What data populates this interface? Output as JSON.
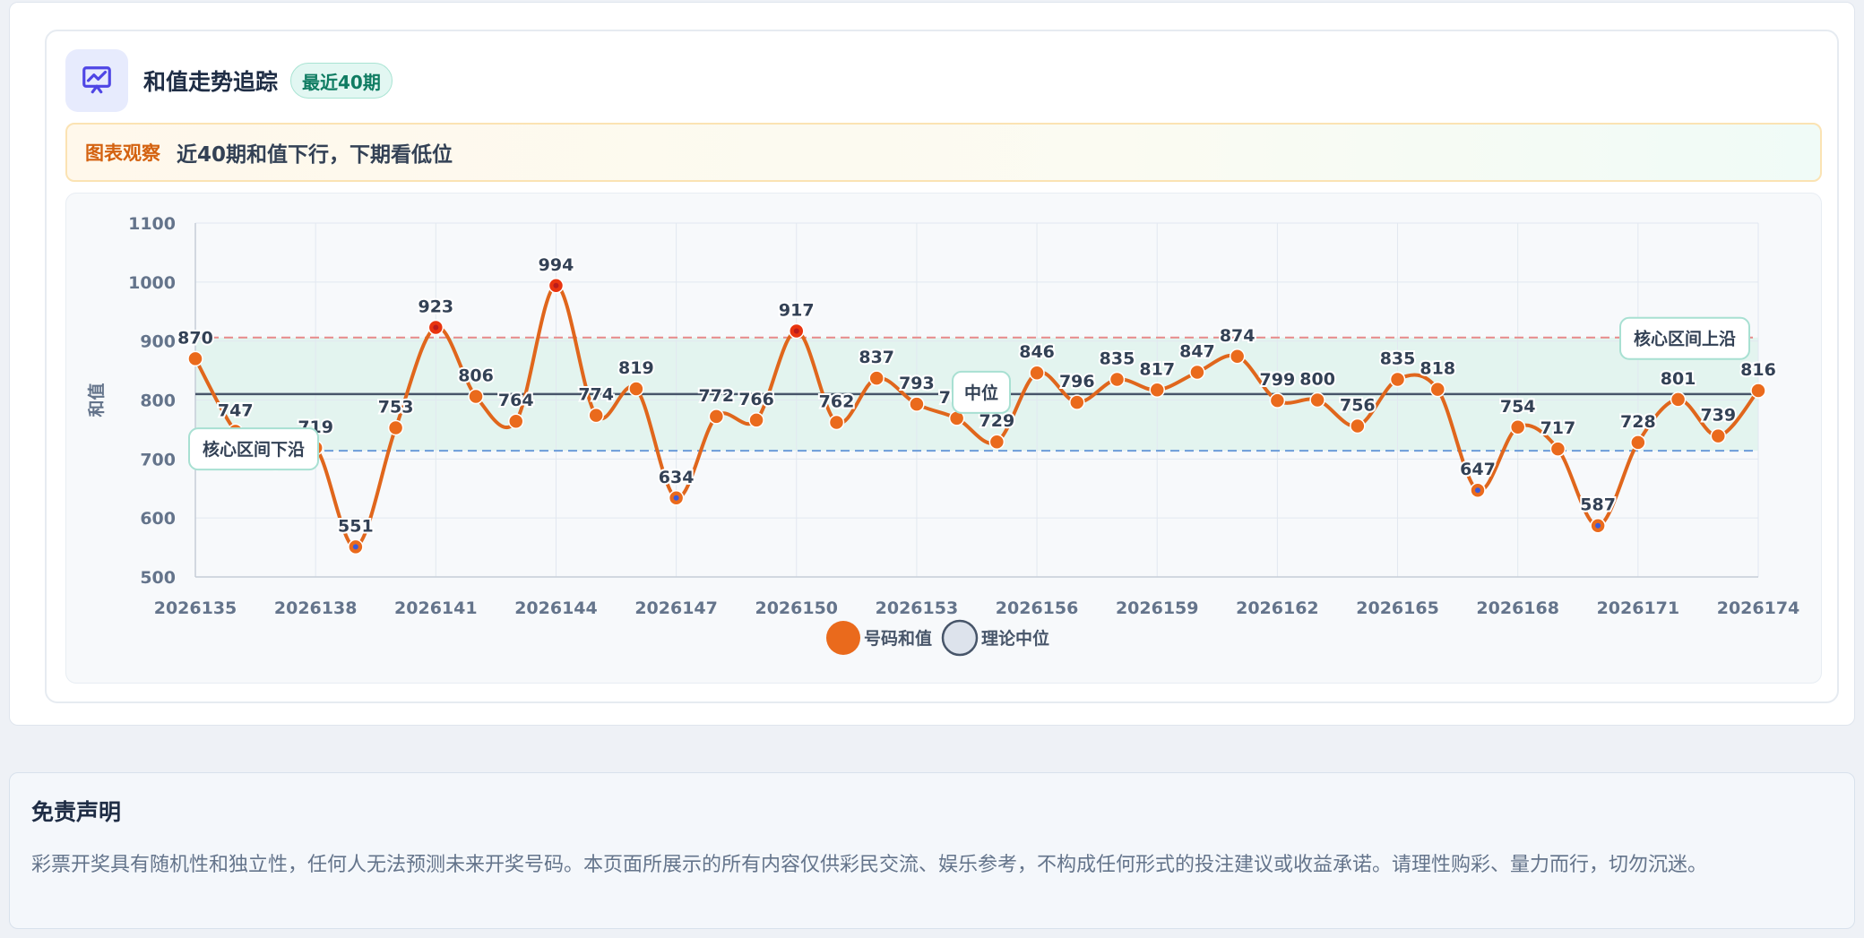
{
  "header": {
    "title": "和值走势追踪",
    "badge": "最近40期",
    "icon": "trend-chart-icon"
  },
  "insight": {
    "label": "图表观察",
    "text": "近40期和值下行，下期看低位"
  },
  "chart_data": {
    "type": "line",
    "x": [
      "2026135",
      "2026136",
      "2026137",
      "2026138",
      "2026139",
      "2026140",
      "2026141",
      "2026142",
      "2026143",
      "2026144",
      "2026145",
      "2026146",
      "2026147",
      "2026148",
      "2026149",
      "2026150",
      "2026151",
      "2026152",
      "2026153",
      "2026154",
      "2026155",
      "2026156",
      "2026157",
      "2026158",
      "2026159",
      "2026160",
      "2026161",
      "2026162",
      "2026163",
      "2026164",
      "2026165",
      "2026166",
      "2026167",
      "2026168",
      "2026169",
      "2026170",
      "2026171",
      "2026172",
      "2026173",
      "2026174"
    ],
    "xticks": [
      "2026135",
      "2026138",
      "2026141",
      "2026144",
      "2026147",
      "2026150",
      "2026153",
      "2026156",
      "2026159",
      "2026162",
      "2026165",
      "2026168",
      "2026171",
      "2026174"
    ],
    "series": [
      {
        "name": "号码和值",
        "values": [
          870,
          747,
          693,
          719,
          551,
          753,
          923,
          806,
          764,
          994,
          774,
          819,
          634,
          772,
          766,
          917,
          762,
          837,
          793,
          769,
          729,
          846,
          796,
          835,
          817,
          847,
          874,
          799,
          800,
          756,
          835,
          818,
          647,
          754,
          717,
          587,
          728,
          801,
          739,
          816
        ]
      },
      {
        "name": "理论中位",
        "values": [
          810
        ]
      }
    ],
    "ylabel": "和值",
    "ylim": [
      500,
      1100
    ],
    "yticks": [
      500,
      600,
      700,
      800,
      900,
      1000,
      1100
    ],
    "band": {
      "low": 714,
      "high": 906
    },
    "annotations": [
      {
        "text": "核心区间上沿",
        "value": 906
      },
      {
        "text": "核心区间下沿",
        "value": 714
      },
      {
        "text": "中位",
        "value": 810
      }
    ],
    "legend_position": "bottom-center",
    "grid": true,
    "colors": {
      "line": "#e0661c",
      "marker": "#ea6a1c",
      "high_marker": "#e9340f",
      "low_marker": "#3b5bd9",
      "median": "#475569",
      "upper": "#e88a8a",
      "lower": "#6b9bd9",
      "band": "#e3f4ef",
      "grid": "#e2e8f0",
      "legend_median_fill": "#dde3ec"
    }
  },
  "disclaimer": {
    "title": "免责声明",
    "text": "彩票开奖具有随机性和独立性，任何人无法预测未来开奖号码。本页面所展示的所有内容仅供彩民交流、娱乐参考，不构成任何形式的投注建议或收益承诺。请理性购彩、量力而行，切勿沉迷。"
  }
}
